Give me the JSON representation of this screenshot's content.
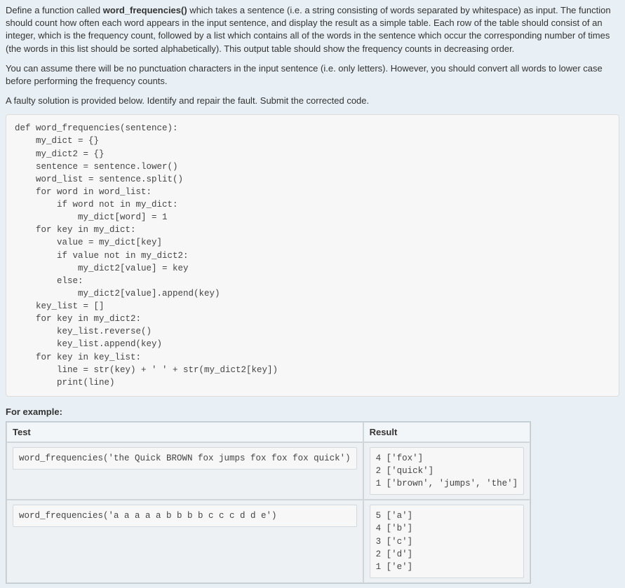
{
  "description": {
    "p1_pre": "Define a function called ",
    "p1_strong": "word_frequencies()",
    "p1_post": " which takes a sentence (i.e. a string consisting of words separated by whitespace) as input.  The function should count how often each word appears in the input sentence, and display the result as a simple table.  Each row of the table should consist of an integer, which is the frequency count, followed by a list which contains all of the words in the sentence which occur the corresponding number of times (the words in this list should be sorted alphabetically).  This output table should show the frequency counts in decreasing order.",
    "p2": "You can assume there will be no punctuation characters in the input sentence (i.e. only letters).  However, you should convert all words to lower case before performing the frequency counts.",
    "p3": "A faulty solution is provided below.  Identify and repair the fault.  Submit the corrected code."
  },
  "code": "def word_frequencies(sentence):\n    my_dict = {}\n    my_dict2 = {}\n    sentence = sentence.lower()\n    word_list = sentence.split()\n    for word in word_list:\n        if word not in my_dict:\n            my_dict[word] = 1\n    for key in my_dict:\n        value = my_dict[key]\n        if value not in my_dict2:\n            my_dict2[value] = key\n        else:\n            my_dict2[value].append(key)\n    key_list = []\n    for key in my_dict2:\n        key_list.reverse()\n        key_list.append(key)\n    for key in key_list:\n        line = str(key) + ' ' + str(my_dict2[key])\n        print(line)",
  "example_label": "For example:",
  "table": {
    "headers": {
      "test": "Test",
      "result": "Result"
    },
    "rows": [
      {
        "test": "word_frequencies('the Quick BROWN fox jumps fox fox fox quick')",
        "result": "4 ['fox']\n2 ['quick']\n1 ['brown', 'jumps', 'the']"
      },
      {
        "test": "word_frequencies('a a a a a b b b b c c c d d e')",
        "result": "5 ['a']\n4 ['b']\n3 ['c']\n2 ['d']\n1 ['e']"
      }
    ]
  }
}
